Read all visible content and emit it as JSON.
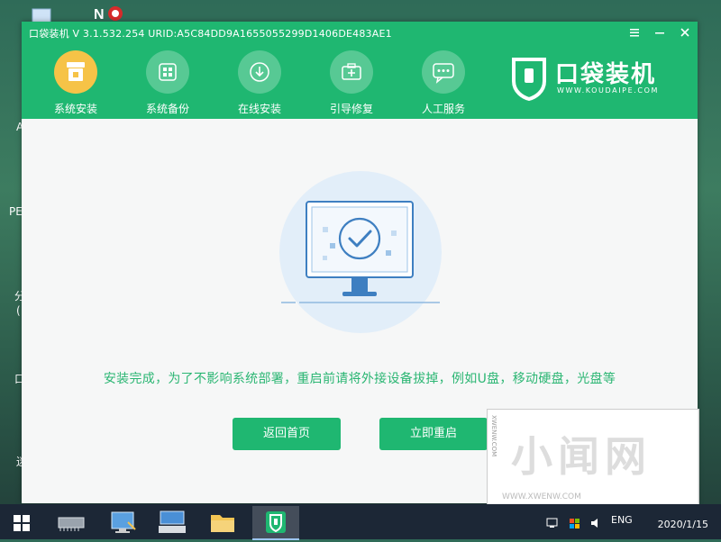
{
  "desktop": {
    "side_labels": [
      "A",
      "PE",
      "分",
      "(",
      "口",
      "迷"
    ]
  },
  "window": {
    "title": "口袋装机 V 3.1.532.254 URID:A5C84DD9A1655055299D1406DE483AE1",
    "controls": {
      "menu": "≡",
      "minimize": "−",
      "close": "×"
    }
  },
  "toolbar": {
    "items": [
      {
        "label": "系统安装",
        "icon": "system-install-icon",
        "active": true
      },
      {
        "label": "系统备份",
        "icon": "system-backup-icon",
        "active": false
      },
      {
        "label": "在线安装",
        "icon": "online-install-icon",
        "active": false
      },
      {
        "label": "引导修复",
        "icon": "boot-repair-icon",
        "active": false
      },
      {
        "label": "人工服务",
        "icon": "chat-service-icon",
        "active": false
      }
    ]
  },
  "brand": {
    "name": "口袋装机",
    "url": "WWW.KOUDAIPE.COM"
  },
  "main": {
    "message": "安装完成，为了不影响系统部署，重启前请将外接设备拔掉，例如U盘，移动硬盘，光盘等",
    "buttons": {
      "home": "返回首页",
      "restart": "立即重启"
    }
  },
  "watermark": {
    "big": "小闻网",
    "small": "WWW.XWENW.COM",
    "side": "XWENW.COM"
  },
  "taskbar": {
    "tray_lang": "ENG",
    "date": "2020/1/15"
  },
  "colors": {
    "brand_green": "#1fb771",
    "active_yellow": "#f6c347",
    "message_green": "#2bb673"
  }
}
